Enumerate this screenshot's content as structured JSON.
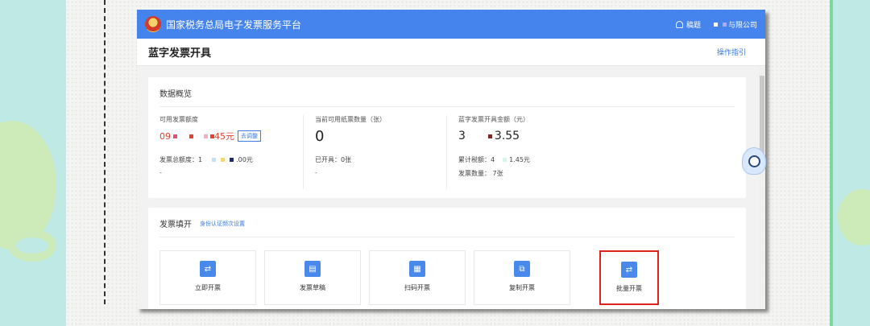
{
  "app": {
    "brand": "国家税务总局电子发票服务平台",
    "user_name": "稿题",
    "company": "与限公司"
  },
  "page": {
    "title": "蓝字发票开具",
    "guide_link": "操作指引"
  },
  "overview": {
    "title": "数据概览",
    "stats": [
      {
        "label": "可用发票额度",
        "value": "09",
        "value_suffix": "45元",
        "adjust_button": "去调整",
        "line2_label": "发票总额度：",
        "line2_value": "1",
        "line2_suffix": ".00元",
        "line3": "-"
      },
      {
        "label": "当前可用纸票数量（张）",
        "value": "0",
        "line2_label": "已开具：",
        "line2_value": "0张",
        "line3": "-"
      },
      {
        "label": "蓝字发票开具金额（元）",
        "value": "3",
        "value_suffix": "3.55",
        "line2_label": "累计税额：",
        "line2_value": "4",
        "line2_suffix": "1.45元",
        "line3_label": "发票数量：",
        "line3_value": "7张"
      }
    ]
  },
  "fill": {
    "title": "发票填开",
    "link": "身份认证频次设置",
    "tiles": [
      {
        "label": "立即开票",
        "icon": "invoice-icon",
        "glyph": "⇄"
      },
      {
        "label": "发票草稿",
        "icon": "draft-icon",
        "glyph": "▤"
      },
      {
        "label": "扫码开票",
        "icon": "qrcode-icon",
        "glyph": "▦"
      },
      {
        "label": "复制开票",
        "icon": "copy-icon",
        "glyph": "⧉"
      },
      {
        "label": "批量开票",
        "icon": "batch-icon",
        "glyph": "⇄"
      }
    ]
  },
  "colors": {
    "topbar": "#4584ec",
    "accent": "#3a7ae4",
    "highlight": "#e0201b",
    "quota_red": "#e6422f"
  }
}
